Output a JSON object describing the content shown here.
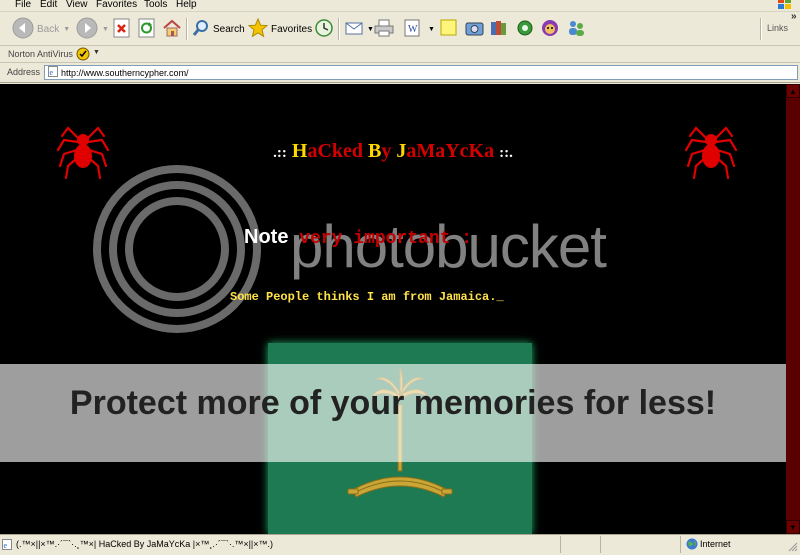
{
  "menu": [
    "File",
    "Edit",
    "View",
    "Favorites",
    "Tools",
    "Help"
  ],
  "toolbar": {
    "back_label": "Back",
    "search_label": "Search",
    "favorites_label": "Favorites",
    "links_label": "Links"
  },
  "norton": {
    "label": "Norton AntiVirus"
  },
  "address": {
    "label": "Address",
    "url": "http://www.southerncypher.com/"
  },
  "page": {
    "headline_prefix": ".::",
    "headline_parts": [
      "H",
      "aCked ",
      "B",
      "y ",
      "J",
      "aMaYcKa"
    ],
    "headline_suffix": "::.",
    "note_word": "Note",
    "note_rest": "very important :",
    "typed_text": "Some People thinks I am from Jamaica._"
  },
  "watermark": {
    "brand": "photobucket",
    "tagline": "Protect more of your memories for less!"
  },
  "status": {
    "text": "(.™×||×™.·´¯`·.¸™×| HaCked By JaMaYcKa |×™¸.·´¯`·.™×||×™.)",
    "zone": "Internet"
  },
  "colors": {
    "page_bg": "#000000",
    "headline_red": "#d40000",
    "headline_yellow": "#ffd800",
    "typed_yellow": "#ffe24a",
    "spider_red": "#e00000",
    "flag_green": "#1e7a52"
  }
}
